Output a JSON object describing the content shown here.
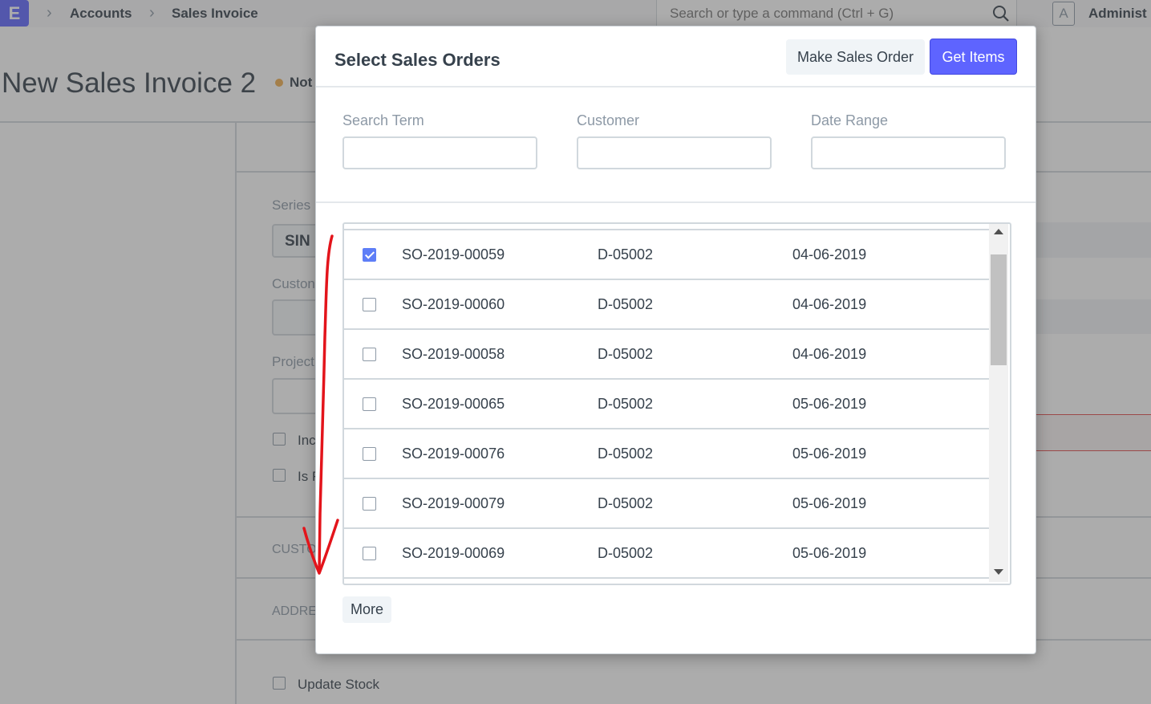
{
  "navbar": {
    "logo": "E",
    "breadcrumbs": [
      "Accounts",
      "Sales Invoice"
    ],
    "search_placeholder": "Search or type a command (Ctrl + G)",
    "avatar_initial": "A",
    "user_label": "Administ"
  },
  "page": {
    "title": "New Sales Invoice 2",
    "status": "Not",
    "form": {
      "series_label": "Series",
      "series_value": "SIN",
      "customer_label": "Custon",
      "project_label": "Project",
      "check_1": "Inc",
      "check_2": "Is F",
      "section_1": "CUSTO",
      "section_2": "ADDRE",
      "update_stock_label": "Update Stock"
    }
  },
  "modal": {
    "title": "Select Sales Orders",
    "make_button": "Make Sales Order",
    "get_items_button": "Get Items",
    "filters": {
      "search_label": "Search Term",
      "customer_label": "Customer",
      "date_label": "Date Range"
    },
    "rows": [
      {
        "checked": true,
        "name": "SO-2019-00059",
        "customer": "D-05002",
        "date": "04-06-2019"
      },
      {
        "checked": false,
        "name": "SO-2019-00060",
        "customer": "D-05002",
        "date": "04-06-2019"
      },
      {
        "checked": false,
        "name": "SO-2019-00058",
        "customer": "D-05002",
        "date": "04-06-2019"
      },
      {
        "checked": false,
        "name": "SO-2019-00065",
        "customer": "D-05002",
        "date": "05-06-2019"
      },
      {
        "checked": false,
        "name": "SO-2019-00076",
        "customer": "D-05002",
        "date": "05-06-2019"
      },
      {
        "checked": false,
        "name": "SO-2019-00079",
        "customer": "D-05002",
        "date": "05-06-2019"
      },
      {
        "checked": false,
        "name": "SO-2019-00069",
        "customer": "D-05002",
        "date": "05-06-2019"
      }
    ],
    "more_button": "More"
  },
  "colors": {
    "primary": "#5e64ff",
    "annotation": "#e3141b"
  }
}
